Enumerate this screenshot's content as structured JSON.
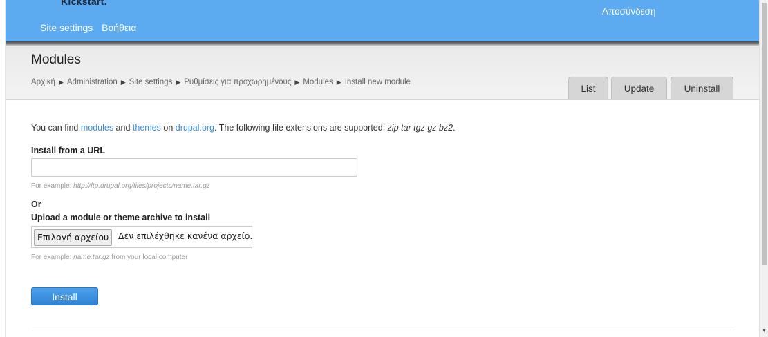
{
  "topbar": {
    "brand": "Kickstart.",
    "nav": [
      "Site settings",
      "Βοήθεια"
    ],
    "logout": "Αποσύνδεση"
  },
  "header": {
    "title": "Modules",
    "breadcrumb": [
      "Αρχική",
      "Administration",
      "Site settings",
      "Ρυθμίσεις για προχωρημένους",
      "Modules",
      "Install new module"
    ],
    "breadcrumb_separator": "▶",
    "tabs": [
      "List",
      "Update",
      "Uninstall"
    ]
  },
  "content": {
    "intro": {
      "part1": "You can find ",
      "modules": "modules",
      "and": " and ",
      "themes": "themes",
      "on": " on ",
      "drupal": "drupal.org",
      "part2": ". The following file extensions are supported: ",
      "extensions": "zip tar tgz gz bz2",
      "end": "."
    },
    "url_label": "Install from a URL",
    "url_value": "",
    "url_desc_prefix": "For example: ",
    "url_desc_example": "http://ftp.drupal.org/files/projects/name.tar.gz",
    "or": "Or",
    "upload_label": "Upload a module or theme archive to install",
    "file_button": "Επιλογή αρχείου",
    "file_status": "Δεν επιλέχθηκε κανένα αρχείο.",
    "upload_desc_prefix": "For example: ",
    "upload_desc_example": "name.tar.gz",
    "upload_desc_suffix": " from your local computer",
    "install_button": "Install"
  },
  "colors": {
    "topbar": "#5caaef",
    "link": "#3b8ee0",
    "button": "#3a8fe0"
  }
}
